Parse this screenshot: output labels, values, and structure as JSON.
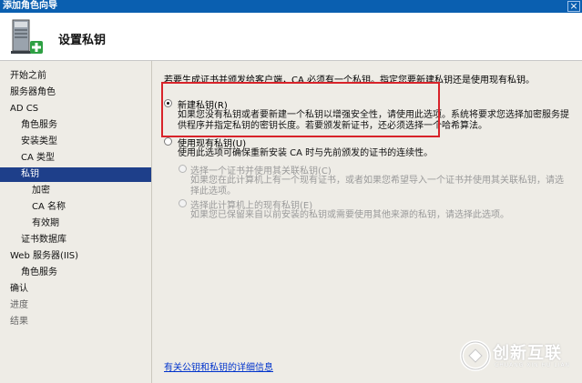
{
  "window": {
    "title": "添加角色向导",
    "close_glyph": "×"
  },
  "header": {
    "title": "设置私钥",
    "icon": "server-install-icon"
  },
  "sidebar": {
    "items": [
      {
        "label": "开始之前",
        "level": 0,
        "state": "normal"
      },
      {
        "label": "服务器角色",
        "level": 0,
        "state": "normal"
      },
      {
        "label": "AD CS",
        "level": 0,
        "state": "normal"
      },
      {
        "label": "角色服务",
        "level": 1,
        "state": "normal"
      },
      {
        "label": "安装类型",
        "level": 1,
        "state": "normal"
      },
      {
        "label": "CA 类型",
        "level": 1,
        "state": "normal"
      },
      {
        "label": "私钥",
        "level": 1,
        "state": "active"
      },
      {
        "label": "加密",
        "level": 2,
        "state": "normal"
      },
      {
        "label": "CA 名称",
        "level": 2,
        "state": "normal"
      },
      {
        "label": "有效期",
        "level": 2,
        "state": "normal"
      },
      {
        "label": "证书数据库",
        "level": 1,
        "state": "normal"
      },
      {
        "label": "Web 服务器(IIS)",
        "level": 0,
        "state": "normal"
      },
      {
        "label": "角色服务",
        "level": 1,
        "state": "normal"
      },
      {
        "label": "确认",
        "level": 0,
        "state": "normal"
      },
      {
        "label": "进度",
        "level": 0,
        "state": "disabled"
      },
      {
        "label": "结果",
        "level": 0,
        "state": "disabled"
      }
    ]
  },
  "main": {
    "intro": "若要生成证书并颁发给客户端，CA 必须有一个私钥。指定您要新建私钥还是使用现有私钥。",
    "options": {
      "new_key": {
        "label": "新建私钥(R)",
        "checked": true,
        "desc_line1": "如果您没有私钥或者要新建一个私钥以增强安全性，请使用此选项。系统将要求您选择加密服务提",
        "desc_line2": "供程序并指定私钥的密钥长度。若要颁发新证书，还必须选择一个哈希算法。"
      },
      "existing_key": {
        "label": "使用现有私钥(U)",
        "checked": false,
        "desc": "使用此选项可确保重新安装 CA 时与先前颁发的证书的连续性。"
      },
      "select_cert": {
        "label": "选择一个证书并使用其关联私钥(C)",
        "enabled": false,
        "desc_line1": "如果您在此计算机上有一个现有证书，或者如果您希望导入一个证书并使用其关联私钥，请选",
        "desc_line2": "择此选项。"
      },
      "select_key": {
        "label": "选择此计算机上的现有私钥(E)",
        "enabled": false,
        "desc": "如果您已保留来自以前安装的私钥或需要使用其他来源的私钥，请选择此选项。"
      }
    },
    "help_link": "有关公钥和私钥的详细信息"
  },
  "watermark": {
    "text": "创新互联",
    "subtext": "CHUANG XIN HU LIAN"
  },
  "colors": {
    "accent": "#1e3f8a",
    "highlight_box": "#d8232a",
    "link": "#0033cc",
    "titlebar": "#0a5fb0"
  }
}
